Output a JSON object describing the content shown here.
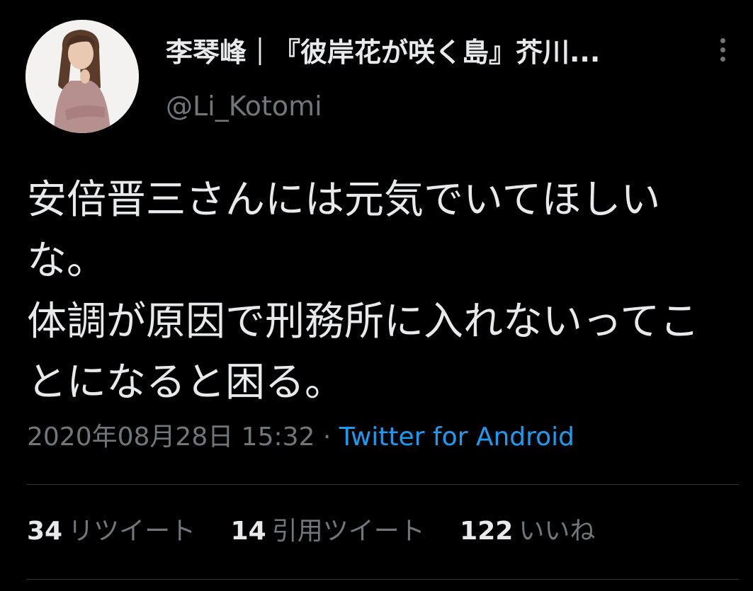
{
  "user": {
    "display_name": "李琴峰｜『彼岸花が咲く島』芥川...",
    "handle": "@Li_Kotomi"
  },
  "tweet": {
    "text": "安倍晋三さんには元気でいてほしいな。\n体調が原因で刑務所に入れないってことになると困る。",
    "timestamp": "2020年08月28日 15:32",
    "separator": "·",
    "source": "Twitter for Android"
  },
  "stats": {
    "retweets_count": "34",
    "retweets_label": "リツイート",
    "quotes_count": "14",
    "quotes_label": "引用ツイート",
    "likes_count": "122",
    "likes_label": "いいね"
  },
  "icons": {
    "more": "more-vertical-icon"
  },
  "colors": {
    "background": "#000000",
    "text": "#e7e9ea",
    "secondary": "#71767b",
    "link": "#1d9bf0",
    "divider": "#2f3336"
  }
}
